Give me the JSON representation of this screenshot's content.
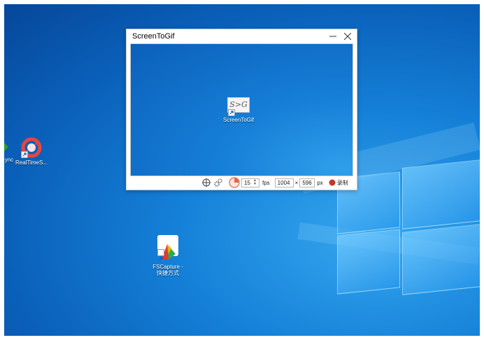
{
  "desktop": {
    "icons": [
      {
        "label": "ync"
      },
      {
        "label": "RealTimeS..."
      },
      {
        "label": "FSCapture -\n快捷方式"
      }
    ]
  },
  "window": {
    "title": "ScreenToGif",
    "capture_icon": {
      "logo_text": "S>G",
      "label": "ScreenToGif"
    },
    "toolbar": {
      "fps_value": "15",
      "fps_label": "fps",
      "width_value": "1004",
      "x_label": "×",
      "height_value": "596",
      "px_label": "px",
      "record_label": "录制"
    }
  },
  "colors": {
    "accent_record": "#c0392b",
    "desktop_blue": "#1580d8"
  }
}
